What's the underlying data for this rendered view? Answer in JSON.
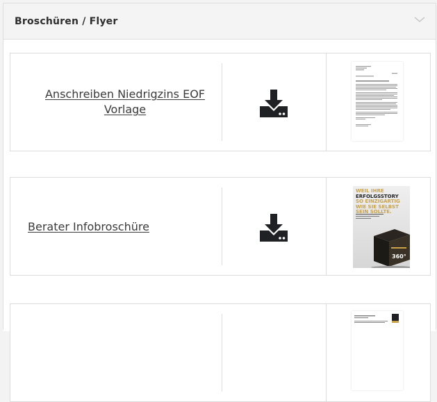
{
  "section": {
    "title": "Broschüren / Flyer"
  },
  "items": [
    {
      "title_line1": "Anschreiben Niedrigzins EOF",
      "title_line2": "Vorlage"
    },
    {
      "title_line1": "Berater Infobroschüre"
    }
  ],
  "brochure": {
    "headline_1": "WEIL IHRE",
    "headline_2": "ERFOLGSSTORY",
    "headline_3": "SO EINZIGARTIG",
    "headline_4": "WIE SIE SELBST",
    "headline_5": "SEIN SOLLTE.",
    "box_number": "360°"
  },
  "icons": {
    "download": "download-icon",
    "collapse": "chevron-down-icon"
  },
  "colors": {
    "link": "#3a3a3a",
    "icon": "#1f2125",
    "brochure_accent": "#c9a24a"
  }
}
